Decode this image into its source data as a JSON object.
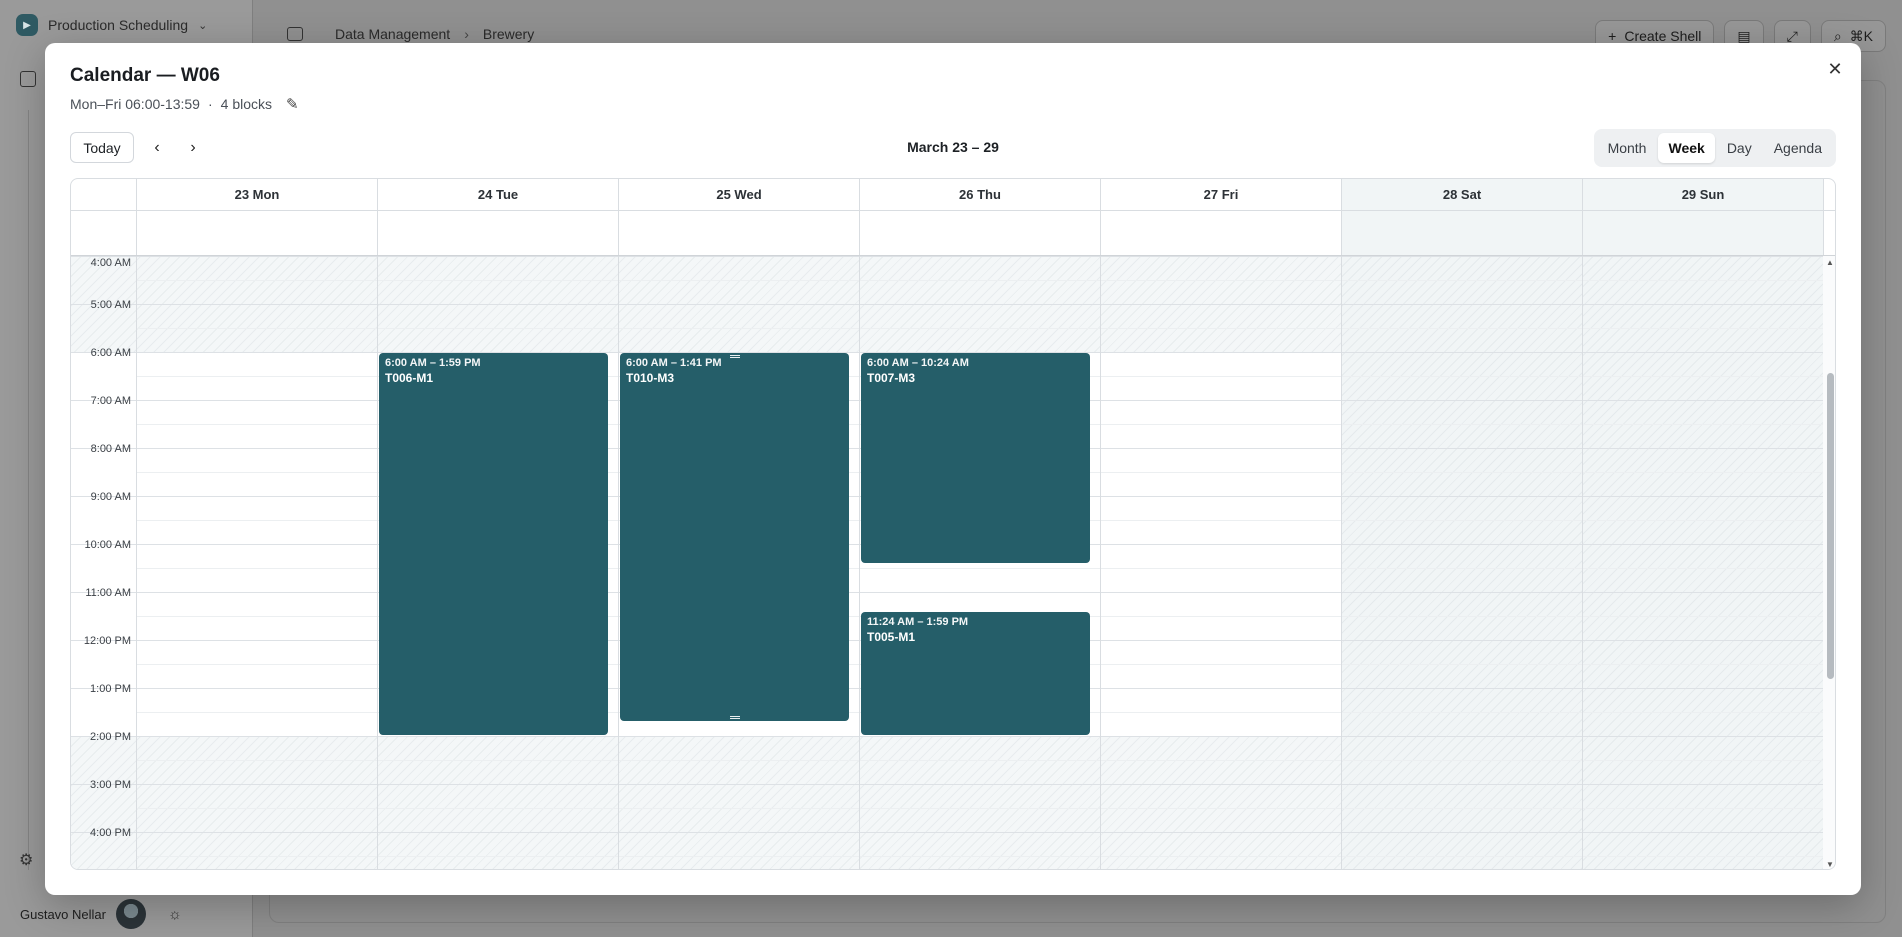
{
  "app": {
    "name": "Production Scheduling",
    "user": "Gustavo Nellar",
    "breadcrumb": [
      "Data Management",
      "Brewery"
    ],
    "create_label": "Create Shell",
    "shortcut": "⌘K"
  },
  "modal": {
    "title": "Calendar — W06",
    "schedule": "Mon–Fri 06:00-13:59",
    "separator": "·",
    "blocks": "4 blocks"
  },
  "toolbar": {
    "today": "Today",
    "range": "March 23 – 29",
    "views": [
      "Month",
      "Week",
      "Day",
      "Agenda"
    ],
    "active_view": "Week"
  },
  "days": [
    {
      "label": "23 Mon",
      "weekend": false
    },
    {
      "label": "24 Tue",
      "weekend": false
    },
    {
      "label": "25 Wed",
      "weekend": false
    },
    {
      "label": "26 Thu",
      "weekend": false
    },
    {
      "label": "27 Fri",
      "weekend": false
    },
    {
      "label": "28 Sat",
      "weekend": true
    },
    {
      "label": "29 Sun",
      "weekend": true
    }
  ],
  "hours": [
    "4:00 AM",
    "5:00 AM",
    "6:00 AM",
    "7:00 AM",
    "8:00 AM",
    "9:00 AM",
    "10:00 AM",
    "11:00 AM",
    "12:00 PM",
    "1:00 PM",
    "2:00 PM",
    "3:00 PM",
    "4:00 PM"
  ],
  "working_hours": {
    "start": 6,
    "end": 14
  },
  "events": [
    {
      "day": 1,
      "start": 6.0,
      "end": 13.983,
      "time": "6:00 AM – 1:59 PM",
      "title": "T006-M1"
    },
    {
      "day": 2,
      "start": 6.0,
      "end": 13.683,
      "time": "6:00 AM – 1:41 PM",
      "title": "T010-M3",
      "selected": true
    },
    {
      "day": 3,
      "start": 6.0,
      "end": 10.4,
      "time": "6:00 AM – 10:24 AM",
      "title": "T007-M3"
    },
    {
      "day": 3,
      "start": 11.4,
      "end": 13.983,
      "time": "11:24 AM – 1:59 PM",
      "title": "T005-M1"
    }
  ],
  "colors": {
    "event": "#255e69",
    "weekend": "#f1f5f6"
  }
}
